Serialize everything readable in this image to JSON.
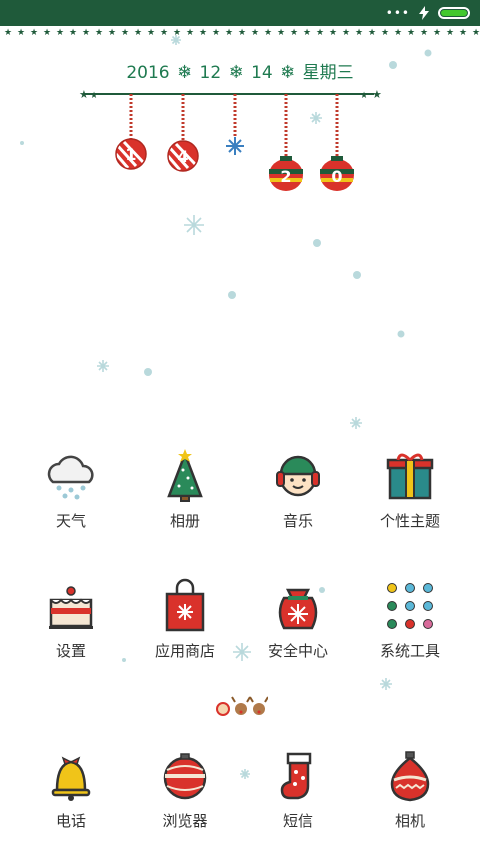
{
  "status_bar": {
    "battery_level": 1.0,
    "battery_color": "#42c82d",
    "icons": [
      "more-dots-icon",
      "charging-bolt-icon",
      "battery-icon"
    ]
  },
  "date": {
    "year": "2016",
    "month": "12",
    "day": "14",
    "weekday": "星期三",
    "separator": "❄"
  },
  "time_ornaments": {
    "digits": [
      "1",
      "4",
      "2",
      "0"
    ]
  },
  "apps": {
    "weather": "天气",
    "album": "相册",
    "music": "音乐",
    "themes": "个性主题",
    "settings": "设置",
    "app_store": "应用商店",
    "security": "安全中心",
    "system_tools": "系统工具",
    "phone": "电话",
    "browser": "浏览器",
    "messages": "短信",
    "camera": "相机"
  },
  "theme_colors": {
    "dark_green": "#1f5a3a",
    "accent_green": "#1f7a50",
    "red": "#d9322b",
    "gold": "#f0c419"
  }
}
